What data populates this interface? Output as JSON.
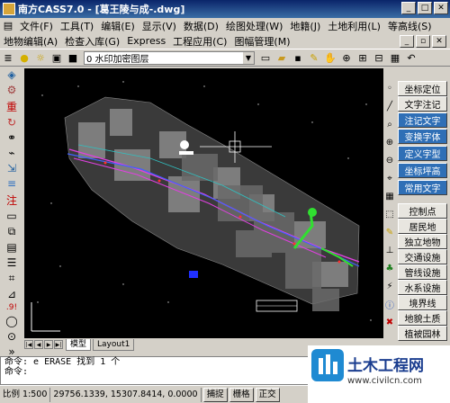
{
  "window": {
    "title": "南方CASS7.0 - [葛王陵与成-.dwg]"
  },
  "menu1": [
    "文件(F)",
    "工具(T)",
    "编辑(E)",
    "显示(V)",
    "数据(D)",
    "绘图处理(W)",
    "地籍(J)",
    "土地利用(L)",
    "等高线(S)"
  ],
  "menu2": [
    "地物编辑(A)",
    "检查入库(G)",
    "Express",
    "工程应用(C)",
    "图幅管理(M)"
  ],
  "toolbar": {
    "layer_name": "0 水印加密图层"
  },
  "right_panel": {
    "buttons": [
      "坐标定位",
      "文字注记",
      "注记文字",
      "变换字体",
      "定义字型",
      "坐标坪高",
      "常用文字",
      "控制点",
      "居民地",
      "独立地物",
      "交通设施",
      "管线设施",
      "水系设施",
      "境界线",
      "地貌土质",
      "植被园林"
    ]
  },
  "tabs": {
    "model": "模型",
    "layout": "Layout1"
  },
  "command": {
    "line1": "命令: e ERASE 找到 1 个",
    "line2": "命令:"
  },
  "status": {
    "scale": "比例 1:500",
    "coords": "29756.1339, 15307.8414, 0.0000",
    "snap": "捕捉",
    "grid": "栅格",
    "ortho": "正交"
  },
  "watermark": {
    "name": "土木工程网",
    "url": "www.civilcn.com"
  },
  "colors": {
    "titlebar": "#0a246a",
    "canvas": "#000000",
    "accent_blue": "#2f6fb6"
  }
}
